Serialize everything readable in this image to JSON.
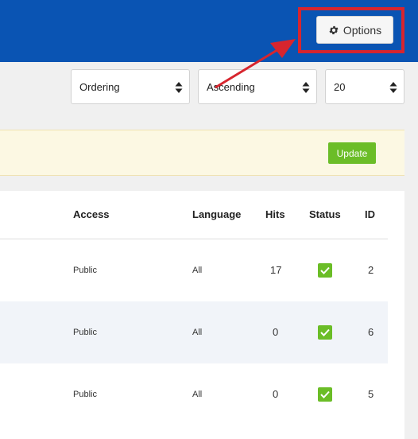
{
  "toolbar": {
    "options_label": "Options",
    "icon": "gear-icon"
  },
  "filters": {
    "ordering": "Ordering",
    "direction": "Ascending",
    "limit": "20"
  },
  "notice": {
    "update_label": "Update"
  },
  "table": {
    "columns": {
      "access": "Access",
      "language": "Language",
      "hits": "Hits",
      "status": "Status",
      "id": "ID"
    },
    "rows": [
      {
        "access": "Public",
        "language": "All",
        "hits": "17",
        "status": "published",
        "id": "2"
      },
      {
        "access": "Public",
        "language": "All",
        "hits": "0",
        "status": "published",
        "id": "6"
      },
      {
        "access": "Public",
        "language": "All",
        "hits": "0",
        "status": "published",
        "id": "5"
      }
    ]
  },
  "colors": {
    "topbar": "#0a54b3",
    "highlight": "#d7252e",
    "success": "#6bbd27"
  }
}
